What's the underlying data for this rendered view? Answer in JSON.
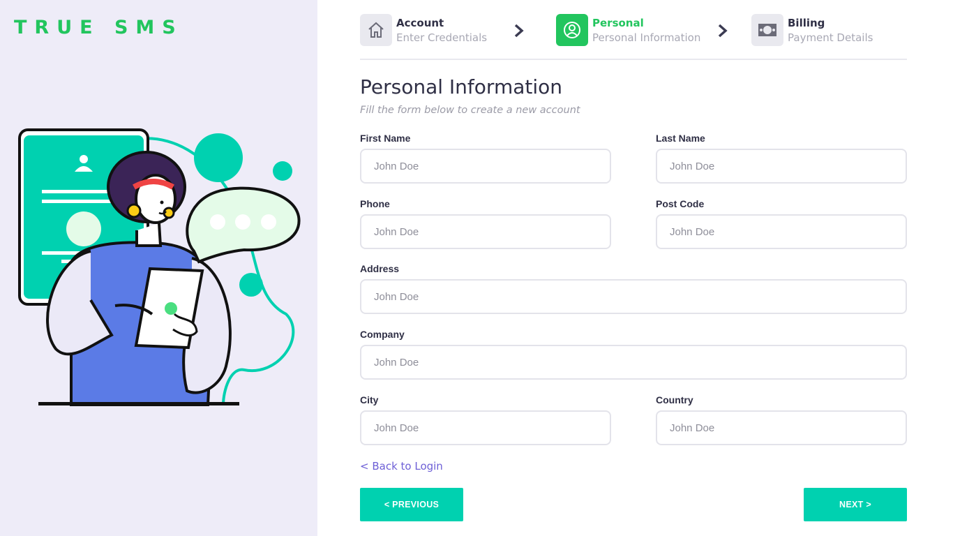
{
  "brand": {
    "name": "TRUE SMS",
    "color": "#22c55e"
  },
  "steps": [
    {
      "title": "Account",
      "subtitle": "Enter Credentials",
      "icon": "home-icon",
      "active": false
    },
    {
      "title": "Personal",
      "subtitle": "Personal Information",
      "icon": "user-circle-icon",
      "active": true
    },
    {
      "title": "Billing",
      "subtitle": "Payment Details",
      "icon": "banknote-icon",
      "active": false
    }
  ],
  "form": {
    "heading": "Personal Information",
    "subheading": "Fill the form below to create a new account",
    "fields": {
      "first_name": {
        "label": "First Name",
        "placeholder": "John Doe",
        "value": ""
      },
      "last_name": {
        "label": "Last Name",
        "placeholder": "John Doe",
        "value": ""
      },
      "phone": {
        "label": "Phone",
        "placeholder": "John Doe",
        "value": ""
      },
      "post_code": {
        "label": "Post Code",
        "placeholder": "John Doe",
        "value": ""
      },
      "address": {
        "label": "Address",
        "placeholder": "John Doe",
        "value": ""
      },
      "company": {
        "label": "Company",
        "placeholder": "John Doe",
        "value": ""
      },
      "city": {
        "label": "City",
        "placeholder": "John Doe",
        "value": ""
      },
      "country": {
        "label": "Country",
        "placeholder": "John Doe",
        "value": ""
      }
    }
  },
  "links": {
    "back_to_login": "< Back to Login"
  },
  "buttons": {
    "previous": "<  PREVIOUS",
    "next": "NEXT  >"
  },
  "colors": {
    "accent": "#22c55e",
    "button": "#00d1b0",
    "link": "#6d5fd6",
    "sidebar_bg": "#eeecf8"
  }
}
